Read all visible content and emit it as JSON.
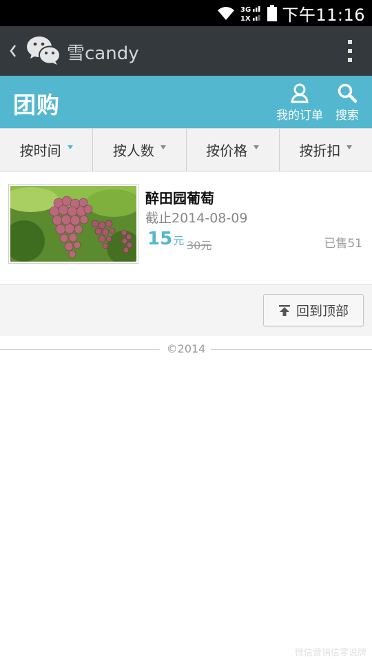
{
  "status_bar": {
    "network_top": "3G",
    "network_bottom": "1X",
    "time": "下午11:16"
  },
  "wechat_bar": {
    "account_name": "雪candy",
    "icons": {
      "back": "chevron-left-icon",
      "logo": "wechat-logo",
      "more": "more-vertical-icon"
    }
  },
  "header": {
    "title": "团购",
    "orders_label": "我的订单",
    "search_label": "搜索",
    "accent_color": "#53b7cf"
  },
  "sort_tabs": [
    {
      "label": "按时间",
      "active": true
    },
    {
      "label": "按人数",
      "active": false
    },
    {
      "label": "按价格",
      "active": false
    },
    {
      "label": "按折扣",
      "active": false
    }
  ],
  "products": [
    {
      "name": "醉田园葡萄",
      "deadline": "截止2014-08-09",
      "price": "15",
      "price_unit": "元",
      "original_price": "30元",
      "sold": "已售51"
    }
  ],
  "back_to_top_label": "回到顶部",
  "footer": {
    "copyright": "©2014"
  },
  "watermark": "微信营销信零说牌"
}
